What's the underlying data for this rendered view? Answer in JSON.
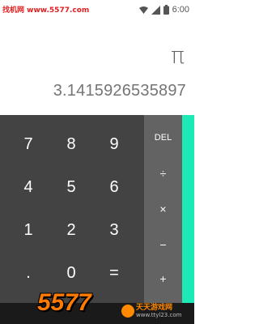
{
  "status_bar": {
    "watermark": "找机网 www.5577.com",
    "time": "6:00"
  },
  "display": {
    "formula": "π",
    "result": "3.1415926535897"
  },
  "keypad": {
    "rows": [
      [
        "7",
        "8",
        "9"
      ],
      [
        "4",
        "5",
        "6"
      ],
      [
        "1",
        "2",
        "3"
      ],
      [
        ".",
        "0",
        "="
      ]
    ]
  },
  "operators": {
    "delete": "DEL",
    "divide": "÷",
    "multiply": "×",
    "subtract": "−",
    "add": "+"
  },
  "watermark": {
    "brand": "5577",
    "site_name": "天天游戏网",
    "site_url": "www.ttyl23.com"
  },
  "colors": {
    "keypad": "#434343",
    "operator_panel": "#636363",
    "accent": "#1de9b6"
  }
}
